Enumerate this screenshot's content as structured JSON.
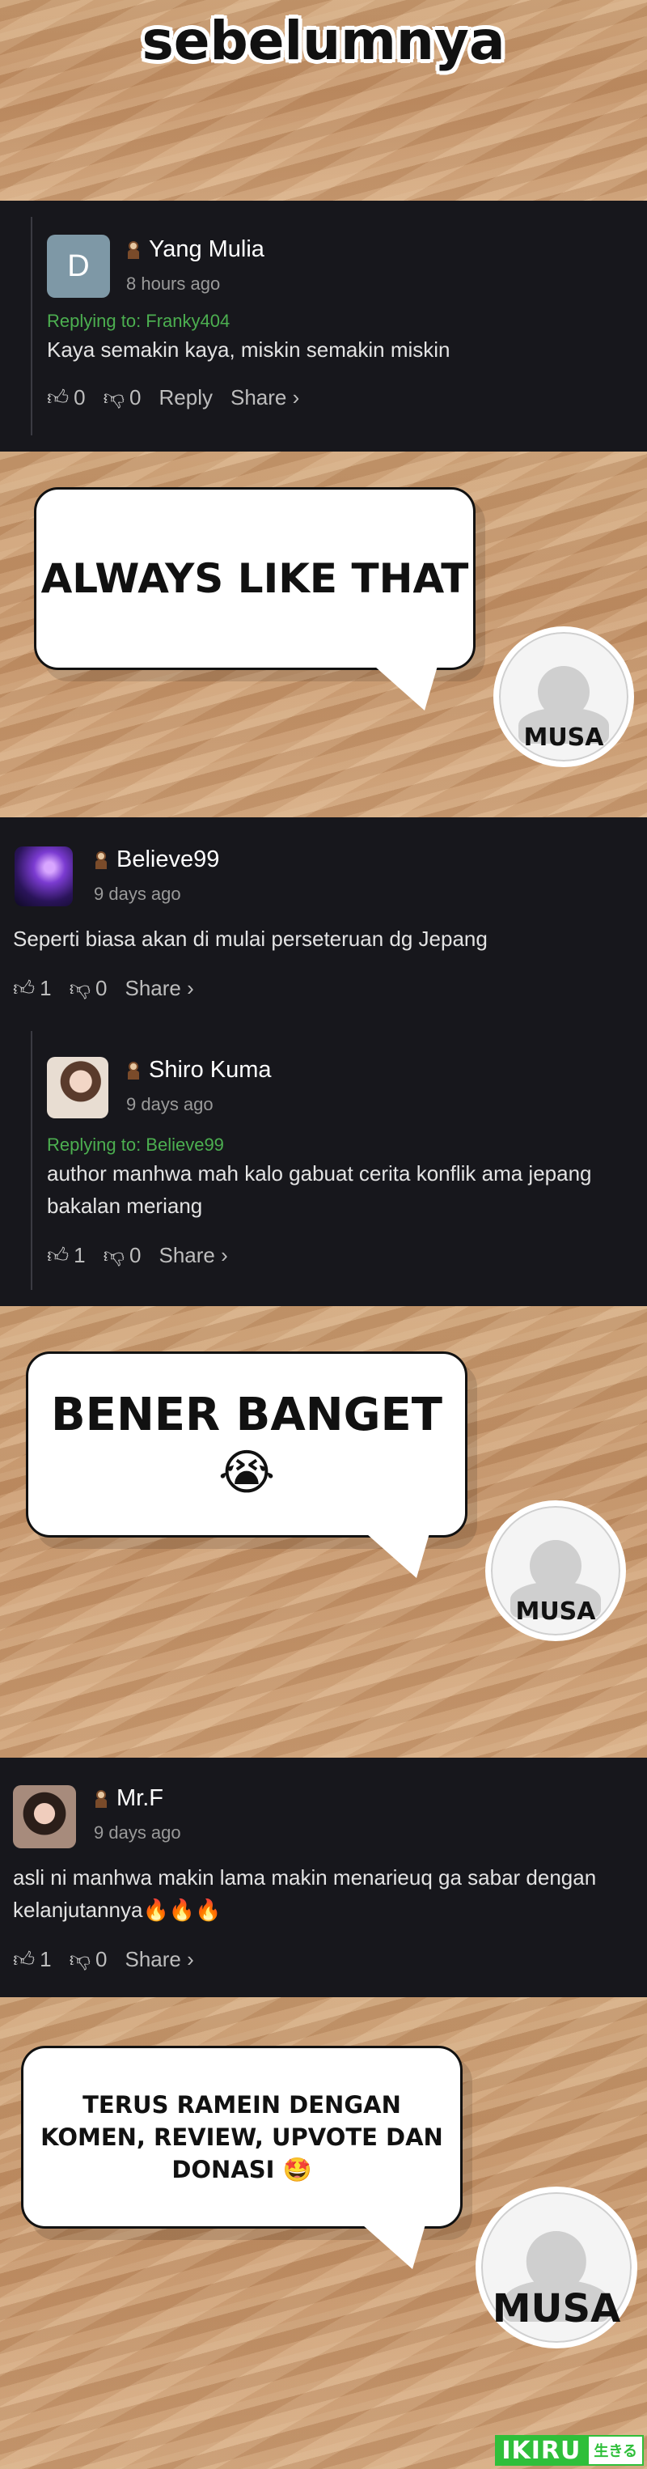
{
  "header": {
    "title": "sebelumnya"
  },
  "comments": [
    {
      "avatar_letter": "D",
      "name": "Yang Mulia",
      "time": "8 hours ago",
      "replying_to": "Replying to: Franky404",
      "text": "Kaya semakin kaya, miskin semakin miskin",
      "likes": "0",
      "dislikes": "0",
      "reply_label": "Reply",
      "share_label": "Share ›"
    },
    {
      "name": "Believe99",
      "time": "9 days ago",
      "text": "Seperti biasa akan di mulai perseteruan dg Jepang",
      "likes": "1",
      "dislikes": "0",
      "share_label": "Share ›"
    },
    {
      "name": "Shiro Kuma",
      "time": "9 days ago",
      "replying_to": "Replying to: Believe99",
      "text_line1": "author manhwa mah kalo gabuat cerita konflik ama jepang",
      "text_line2": "bakalan meriang",
      "likes": "1",
      "dislikes": "0",
      "share_label": "Share ›"
    },
    {
      "name": "Mr.F",
      "time": "9 days ago",
      "text_line1": "asli ni manhwa makin lama makin menarieuq ga sabar dengan",
      "text_line2": "kelanjutannya🔥🔥🔥",
      "likes": "1",
      "dislikes": "0",
      "share_label": "Share ›"
    }
  ],
  "bubbles": [
    {
      "text": "ALWAYS LIKE THAT",
      "profile_label": "MUSA"
    },
    {
      "text": "BENER BANGET",
      "emoji": "😭",
      "profile_label": "MUSA"
    },
    {
      "line1": "TERUS RAMEIN DENGAN",
      "line2": "KOMEN, REVIEW, UPVOTE DAN",
      "line3": "DONASI 🤩",
      "profile_label": "MUSA"
    }
  ],
  "watermark": {
    "brand": "IKIRU",
    "suffix": "生きる",
    "brand_color": "#2fbf3a"
  }
}
